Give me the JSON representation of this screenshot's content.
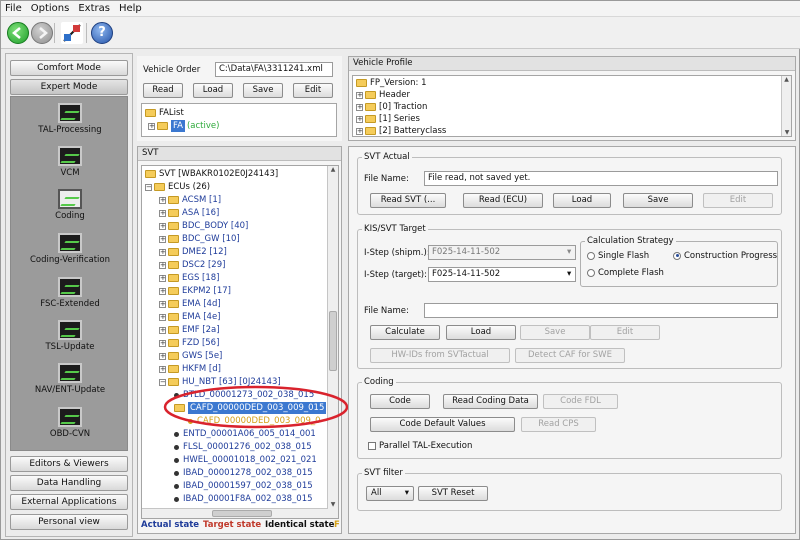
{
  "menu": [
    "File",
    "Options",
    "Extras",
    "Help"
  ],
  "toolbar": {
    "icons": [
      "back-icon",
      "forward-icon",
      "connection-icon",
      "help-icon"
    ]
  },
  "left": {
    "comfort_mode": "Comfort Mode",
    "expert_mode": "Expert Mode",
    "tools": [
      "TAL-Processing",
      "VCM",
      "Coding",
      "Coding-Verification",
      "FSC-Extended",
      "TSL-Update",
      "NAV/ENT-Update",
      "OBD-CVN"
    ],
    "selected_tool": "Coding",
    "bottom": [
      "Editors & Viewers",
      "Data Handling",
      "External Applications",
      "Personal view"
    ]
  },
  "vehicle_order": {
    "label": "Vehicle Order",
    "path": "C:\\Data\\FA\\3311241.xml",
    "read": "Read",
    "load": "Load",
    "save": "Save",
    "edit": "Edit",
    "falist": "FAList",
    "fa": "FA",
    "fa_state": "(active)"
  },
  "vehicle_profile": {
    "title": "Vehicle Profile",
    "items": [
      "FP_Version: 1",
      "Header",
      "[0] Traction",
      "[1] Series",
      "[2] Batteryclass"
    ]
  },
  "svt": {
    "title": "SVT",
    "root": "SVT [WBAKR0102E0J24143]",
    "ecus_label": "ECUs (26)",
    "ecus": [
      "ACSM [1]",
      "ASA [16]",
      "BDC_BODY [40]",
      "BDC_GW [10]",
      "DME2 [12]",
      "DSC2 [29]",
      "EGS [18]",
      "EKPM2 [17]",
      "EMA [4d]",
      "EMA [4e]",
      "EMF [2a]",
      "FZD [56]",
      "GWS [5e]",
      "HKFM [d]",
      "HU_NBT [63] [0J24143]"
    ],
    "children": [
      "BTLD_00001273_002_038_015",
      "CAFD_00000DED_003_009_015",
      "CAFD_00000DED_003_009_0",
      "ENTD_00001A06_005_014_001",
      "FLSL_00001276_002_038_015",
      "HWEL_00001018_002_021_021",
      "IBAD_00001278_002_038_015",
      "IBAD_00001597_002_038_015",
      "IBAD_00001F8A_002_038_015"
    ],
    "legend": {
      "actual": "Actual state",
      "target": "Target state",
      "identical": "Identical state",
      "extra": "F"
    },
    "colors": {
      "actual": "#1f3c9a",
      "target": "#c0392b",
      "identical": "#111111",
      "extra": "#d4a017"
    }
  },
  "svt_actual": {
    "title": "SVT Actual",
    "file_label": "File Name:",
    "file_value": "File read, not saved yet.",
    "read_svt": "Read SVT (...",
    "read_ecu": "Read (ECU)",
    "load": "Load",
    "save": "Save",
    "edit": "Edit"
  },
  "kis": {
    "title": "KIS/SVT Target",
    "istep_shipm_label": "I-Step (shipm.):",
    "istep_shipm": "F025-14-11-502",
    "istep_target_label": "I-Step (target):",
    "istep_target": "F025-14-11-502",
    "calc_title": "Calculation Strategy",
    "single_flash": "Single Flash",
    "construction_progress": "Construction Progress",
    "complete_flash": "Complete Flash",
    "file_label": "File Name:",
    "calculate": "Calculate",
    "load": "Load",
    "save": "Save",
    "edit": "Edit",
    "hw_ids": "HW-IDs from SVTactual",
    "detect_caf": "Detect CAF for SWE"
  },
  "coding": {
    "title": "Coding",
    "code": "Code",
    "read_coding_data": "Read Coding Data",
    "code_fdl": "Code FDL",
    "code_default": "Code Default Values",
    "read_cps": "Read CPS",
    "parallel": "Parallel TAL-Execution"
  },
  "svt_filter": {
    "title": "SVT filter",
    "value": "All",
    "reset": "SVT Reset"
  },
  "highlight_color": "#d9232d"
}
